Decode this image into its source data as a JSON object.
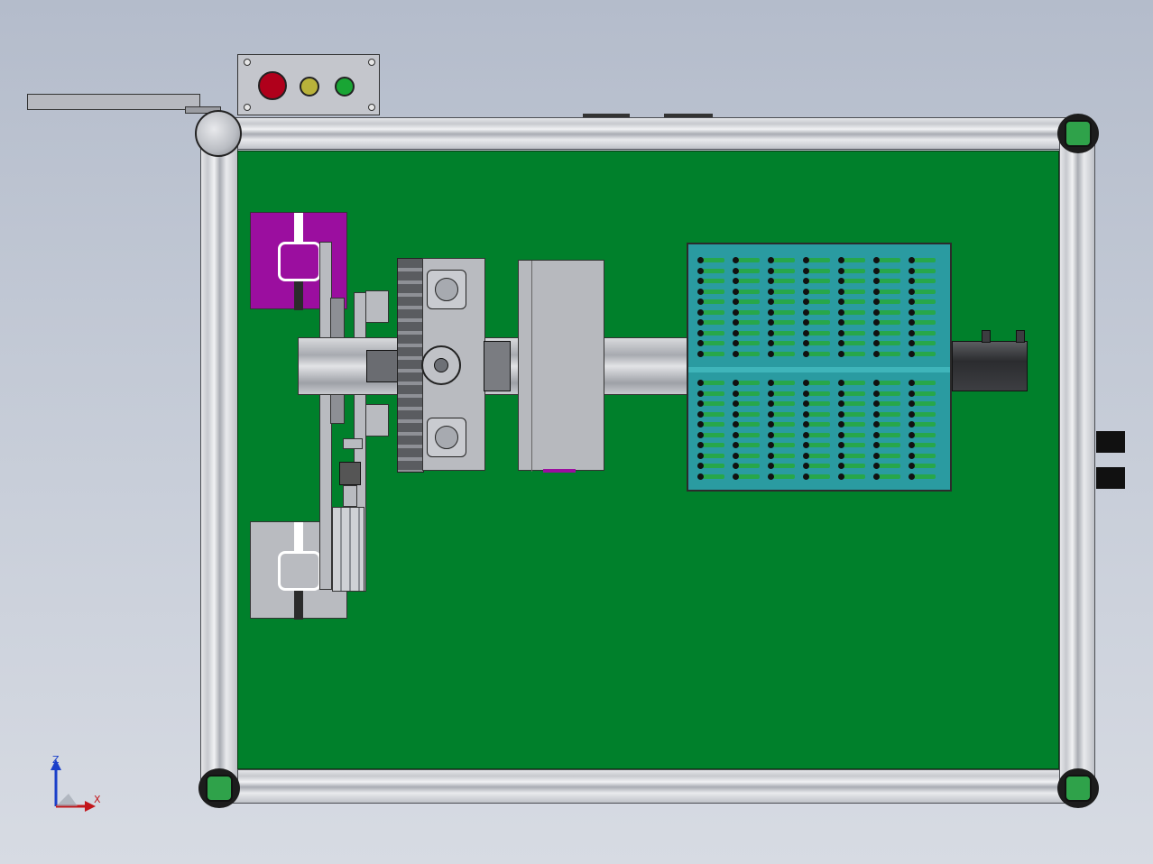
{
  "axis_indicator": {
    "z_label": "Z",
    "x_label": "X"
  },
  "colors": {
    "base_plate": "#00802b",
    "magenta_fixture": "#9b0e9f",
    "tray": "#2a9ba1",
    "button_red": "#b0001b",
    "button_yellow": "#b9b23a",
    "button_green": "#19a534"
  },
  "control_panel": {
    "buttons": [
      "stop-button",
      "pause-button",
      "start-button"
    ]
  }
}
